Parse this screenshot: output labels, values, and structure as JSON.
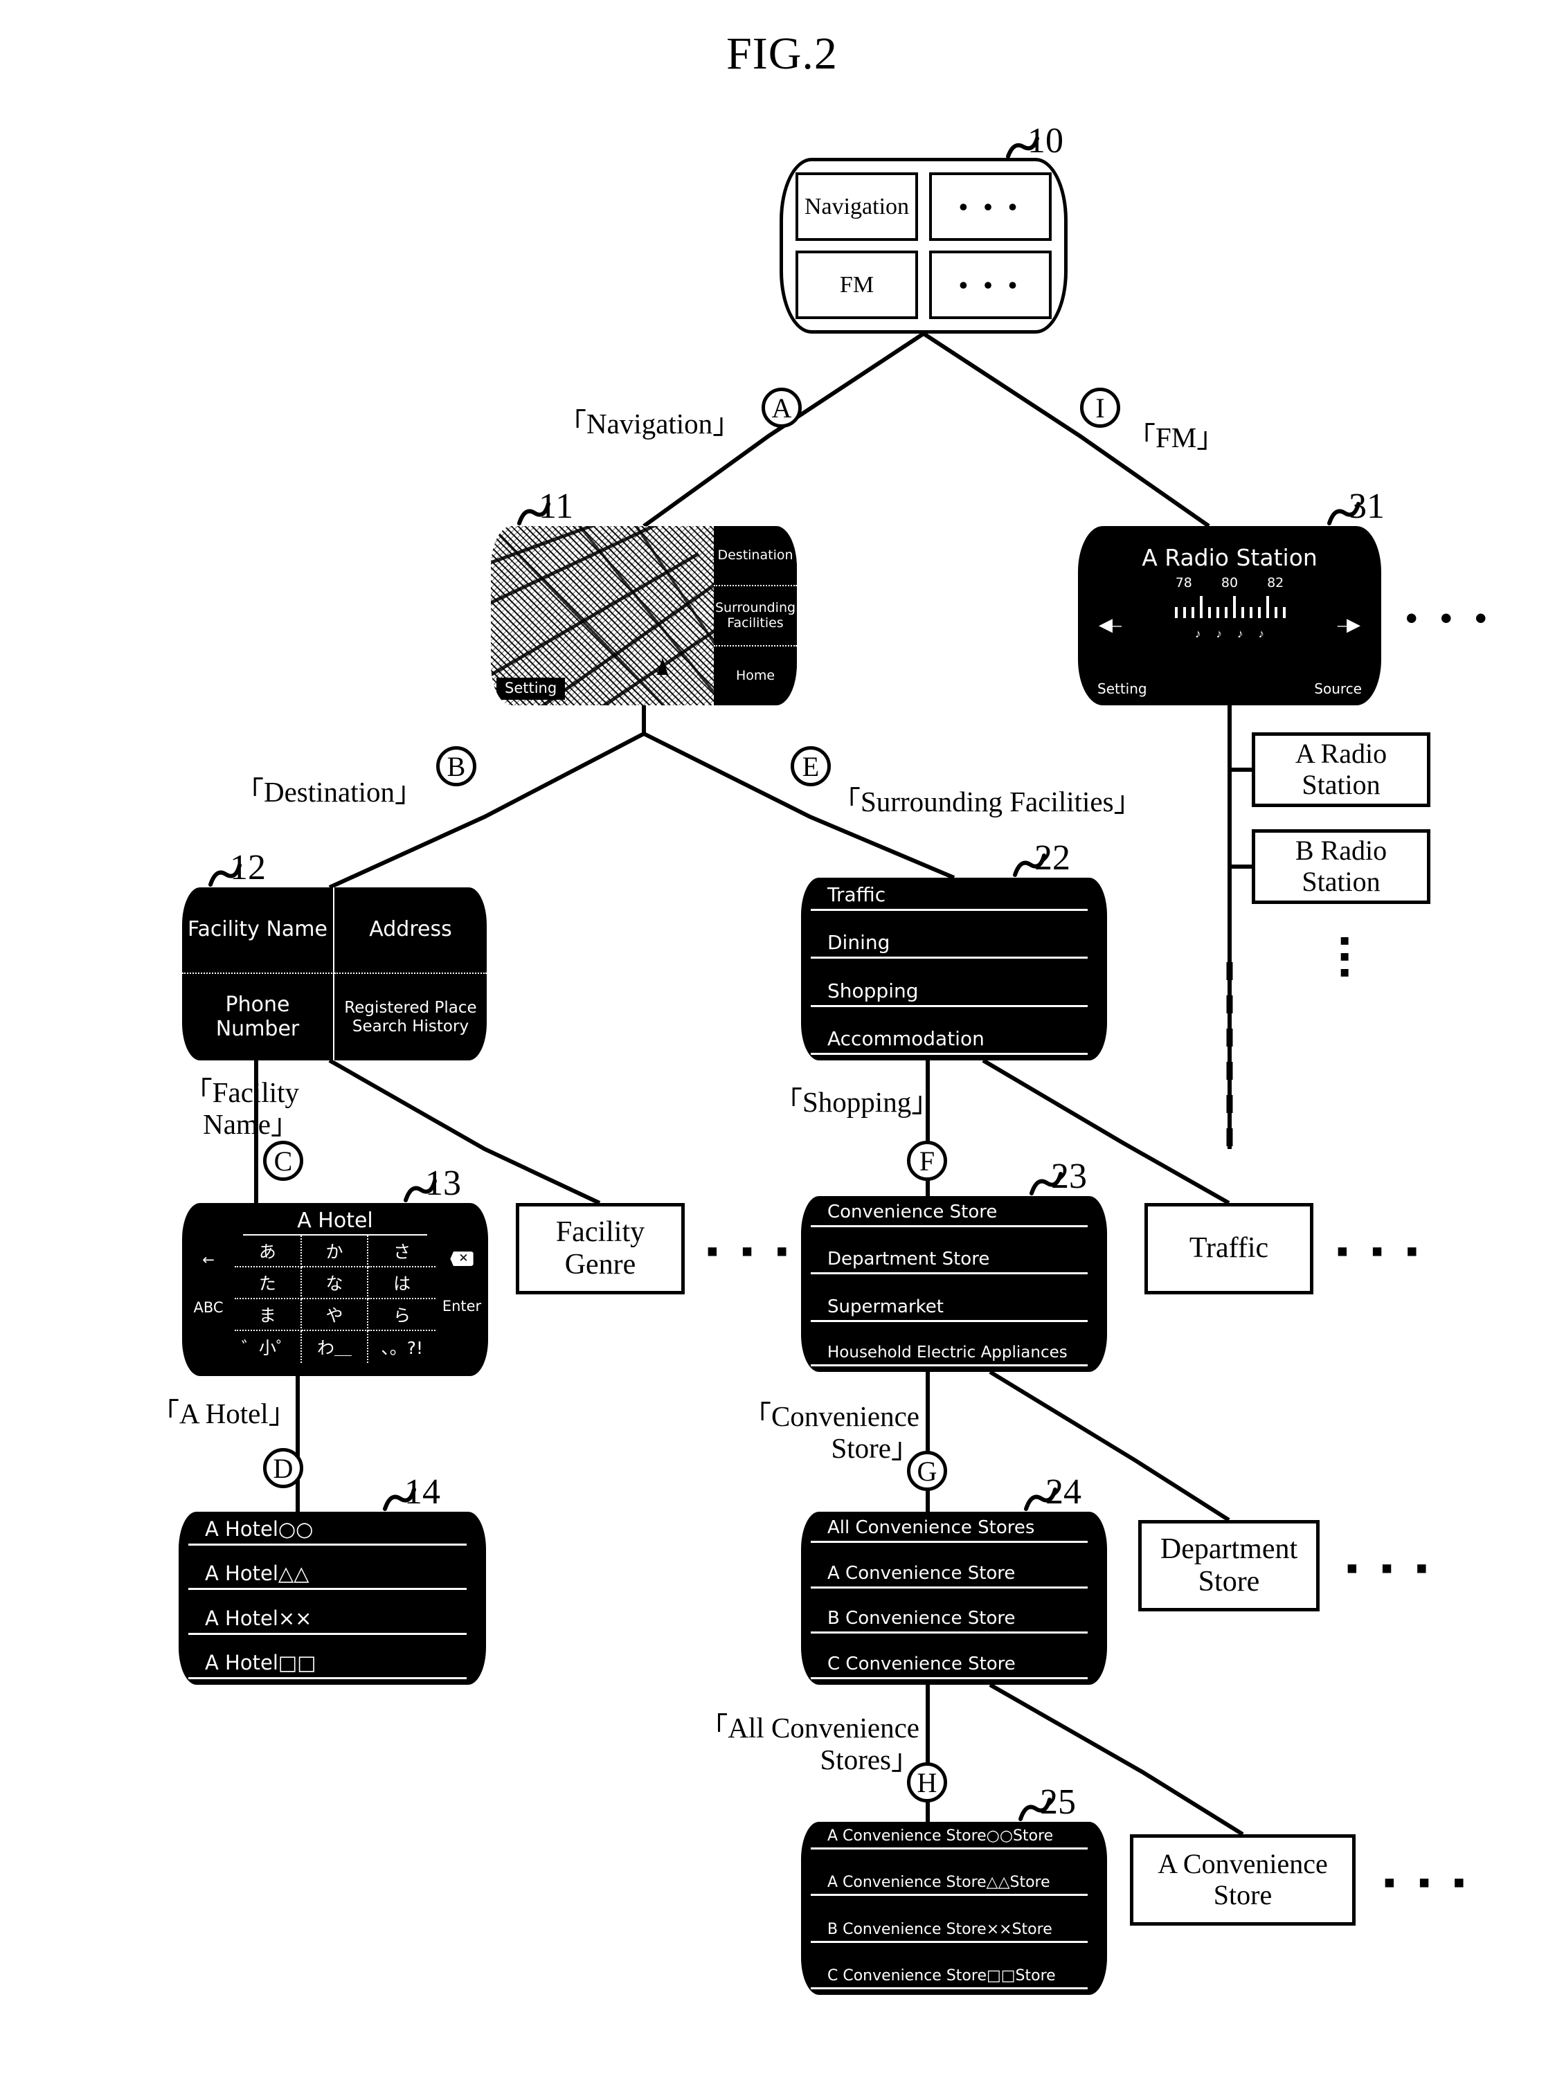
{
  "figure": {
    "title": "FIG.2"
  },
  "nodes": {
    "menu": {
      "ref": "10",
      "tiles": [
        "Navigation",
        "• • •",
        "FM",
        "• • •"
      ]
    },
    "navigation": {
      "ref": "11",
      "sidebar": [
        "Destination",
        "Surrounding Facilities",
        "Home"
      ],
      "setting_label": "Setting"
    },
    "radio": {
      "ref": "31",
      "station": "A Radio Station",
      "frequencies": [
        "78",
        "80",
        "82"
      ],
      "presets": [
        "♪",
        "♪",
        "♪",
        "♪"
      ],
      "setting_label": "Setting",
      "source_label": "Source",
      "prev_icon": "◀‒",
      "next_icon": "‒▶",
      "ellipsis": "• • •"
    },
    "destination_menu": {
      "ref": "12",
      "cells": [
        "Facility Name",
        "Address",
        "Phone Number",
        "Registered Place Search History"
      ]
    },
    "keyboard": {
      "ref": "13",
      "title": "A Hotel",
      "back_icon": "←",
      "backspace_icon": "✕",
      "abc_label": "ABC",
      "enter_label": "Enter",
      "keys": [
        "あ",
        "か",
        "さ",
        "た",
        "な",
        "は",
        "ま",
        "や",
        "ら",
        "゛小゜",
        "わ＿",
        "、。?!"
      ]
    },
    "hotel_list": {
      "ref": "14",
      "rows": [
        "A Hotel○○",
        "A Hotel△△",
        "A Hotel××",
        "A Hotel□□"
      ]
    },
    "facilities_menu": {
      "ref": "22",
      "rows": [
        "Traffic",
        "Dining",
        "Shopping",
        "Accommodation"
      ]
    },
    "shopping_menu": {
      "ref": "23",
      "rows": [
        "Convenience Store",
        "Department Store",
        "Supermarket",
        "Household Electric Appliances"
      ]
    },
    "convenience_menu": {
      "ref": "24",
      "rows": [
        "All Convenience Stores",
        "A Convenience Store",
        "B Convenience Store",
        "C Convenience Store"
      ]
    },
    "store_list": {
      "ref": "25",
      "rows": [
        "A Convenience Store○○Store",
        "A Convenience Store△△Store",
        "B Convenience Store××Store",
        "C Convenience Store□□Store"
      ]
    }
  },
  "side_boxes": {
    "facility_genre": "Facility Genre",
    "traffic": "Traffic",
    "department_store": "Department Store",
    "a_convenience_store": "A Convenience Store",
    "radio_station_a": "A Radio Station",
    "radio_station_b": "B Radio Station"
  },
  "edges": [
    {
      "id": "A",
      "marker": "A",
      "label": "「Navigation」"
    },
    {
      "id": "I",
      "marker": "I",
      "label": "「FM」"
    },
    {
      "id": "B",
      "marker": "B",
      "label": "「Destination」"
    },
    {
      "id": "E",
      "marker": "E",
      "label": "「Surrounding Facilities」"
    },
    {
      "id": "C",
      "marker": "C",
      "label": "「Facility Name」"
    },
    {
      "id": "F",
      "marker": "F",
      "label": "「Shopping」"
    },
    {
      "id": "D",
      "marker": "D",
      "label": "「A Hotel」"
    },
    {
      "id": "G",
      "marker": "G",
      "label": "「Convenience Store」"
    },
    {
      "id": "H",
      "marker": "H",
      "label": "「All Convenience Stores」"
    }
  ],
  "edge_label_lines": {
    "facility_name_1": "「Facility",
    "facility_name_2": "Name」",
    "convenience_store_1": "「Convenience",
    "convenience_store_2": "Store」",
    "all_convenience_1": "「All Convenience",
    "all_convenience_2": "Stores」"
  },
  "ellipsis": {
    "horizontal": "▪ ▪ ▪",
    "vertical": "▪▪▪"
  }
}
